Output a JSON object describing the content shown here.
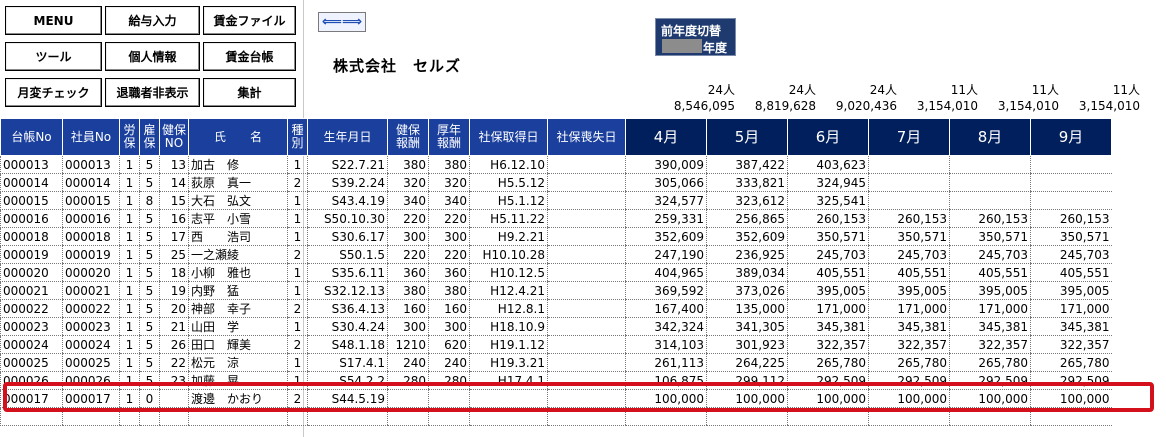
{
  "menu": {
    "menu": "MENU",
    "kyuyo": "給与入力",
    "chingin_file": "賃金ファイル",
    "tool": "ツール",
    "kojin": "個人情報",
    "chingin_daicho": "賃金台帳",
    "getsuhen": "月変チェック",
    "taishoku": "退職者非表示",
    "shukei": "集計"
  },
  "arrow_icon": "⟸⟹",
  "company": "株式会社　セルズ",
  "year_switch": {
    "title": "前年度切替",
    "suffix": "年度"
  },
  "summary": {
    "counts": [
      "24人",
      "24人",
      "24人",
      "11人",
      "11人",
      "11人"
    ],
    "totals": [
      "8,546,095",
      "8,819,628",
      "9,020,436",
      "3,154,010",
      "3,154,010",
      "3,154,010"
    ]
  },
  "headers": [
    "台帳No",
    "社員No",
    "労\n保",
    "雇\n保",
    "健保\nNO",
    "氏　　名",
    "種\n別",
    "生年月日",
    "健保\n報酬",
    "厚年\n報酬",
    "社保取得日",
    "社保喪失日",
    "4月",
    "5月",
    "6月",
    "7月",
    "8月",
    "9月"
  ],
  "rows": [
    [
      "000013",
      "000013",
      "1",
      "5",
      "13",
      "加古　修",
      "1",
      "S22.7.21",
      "380",
      "380",
      "H6.12.10",
      "",
      "390,009",
      "387,422",
      "403,623",
      "",
      "",
      ""
    ],
    [
      "000014",
      "000014",
      "1",
      "5",
      "14",
      "荻原　真一",
      "2",
      "S39.2.24",
      "320",
      "320",
      "H5.5.12",
      "",
      "305,066",
      "333,821",
      "324,945",
      "",
      "",
      ""
    ],
    [
      "000015",
      "000015",
      "1",
      "8",
      "15",
      "大石　弘文",
      "1",
      "S43.4.19",
      "340",
      "340",
      "H5.1.12",
      "",
      "324,577",
      "323,612",
      "325,541",
      "",
      "",
      ""
    ],
    [
      "000016",
      "000016",
      "1",
      "5",
      "16",
      "志平　小雪",
      "1",
      "S50.10.30",
      "220",
      "220",
      "H5.11.22",
      "",
      "259,331",
      "256,865",
      "260,153",
      "260,153",
      "260,153",
      "260,153"
    ],
    [
      "000018",
      "000018",
      "1",
      "5",
      "17",
      "西　　浩司",
      "1",
      "S30.6.17",
      "300",
      "300",
      "H9.2.21",
      "",
      "352,609",
      "352,609",
      "350,571",
      "350,571",
      "350,571",
      "350,571"
    ],
    [
      "000019",
      "000019",
      "1",
      "5",
      "25",
      "一之瀬綾",
      "2",
      "S50.1.5",
      "220",
      "220",
      "H10.10.28",
      "",
      "247,190",
      "236,925",
      "245,703",
      "245,703",
      "245,703",
      "245,703"
    ],
    [
      "000020",
      "000020",
      "1",
      "5",
      "18",
      "小柳　雅也",
      "1",
      "S35.6.11",
      "360",
      "360",
      "H10.12.5",
      "",
      "404,965",
      "389,034",
      "405,551",
      "405,551",
      "405,551",
      "405,551"
    ],
    [
      "000021",
      "000021",
      "1",
      "5",
      "19",
      "内野　猛",
      "1",
      "S32.12.13",
      "380",
      "380",
      "H12.4.21",
      "",
      "369,592",
      "373,026",
      "395,005",
      "395,005",
      "395,005",
      "395,005"
    ],
    [
      "000022",
      "000022",
      "1",
      "5",
      "20",
      "神部　幸子",
      "2",
      "S36.4.13",
      "160",
      "160",
      "H12.8.1",
      "",
      "167,400",
      "135,000",
      "171,000",
      "171,000",
      "171,000",
      "171,000"
    ],
    [
      "000023",
      "000023",
      "1",
      "5",
      "21",
      "山田　学",
      "1",
      "S30.4.24",
      "300",
      "300",
      "H18.10.9",
      "",
      "342,324",
      "341,305",
      "345,381",
      "345,381",
      "345,381",
      "345,381"
    ],
    [
      "000024",
      "000024",
      "1",
      "5",
      "26",
      "田口　輝美",
      "2",
      "S48.1.18",
      "1210",
      "620",
      "H19.1.12",
      "",
      "314,103",
      "301,923",
      "322,357",
      "322,357",
      "322,357",
      "322,357"
    ],
    [
      "000025",
      "000025",
      "1",
      "5",
      "22",
      "松元　涼",
      "1",
      "S17.4.1",
      "240",
      "240",
      "H19.3.21",
      "",
      "261,113",
      "264,225",
      "265,780",
      "265,780",
      "265,780",
      "265,780"
    ],
    [
      "000026",
      "000026",
      "1",
      "5",
      "23",
      "加藤　晃",
      "1",
      "S54.2.2",
      "280",
      "280",
      "H17.4.1",
      "",
      "106,875",
      "299,112",
      "292,509",
      "292,509",
      "292,509",
      "292,509"
    ],
    [
      "000017",
      "000017",
      "1",
      "0",
      "",
      "渡邊　かおり",
      "2",
      "S44.5.19",
      "",
      "",
      "",
      "",
      "100,000",
      "100,000",
      "100,000",
      "100,000",
      "100,000",
      "100,000"
    ],
    [
      "",
      "",
      "",
      "",
      "",
      "",
      "",
      "",
      "",
      "",
      "",
      "",
      "",
      "",
      "",
      "",
      "",
      ""
    ]
  ]
}
